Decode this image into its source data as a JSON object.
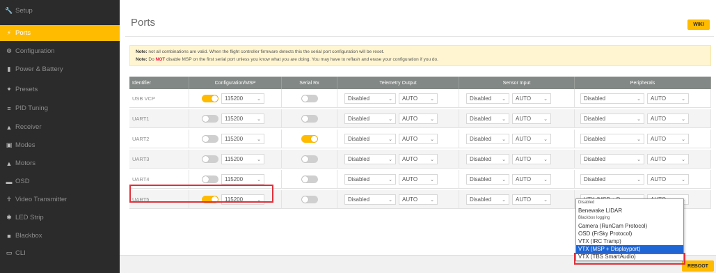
{
  "sidebar": {
    "items": [
      {
        "label": "Setup",
        "icon": "wrench-icon"
      },
      {
        "label": "Ports",
        "icon": "plug-icon",
        "active": true
      },
      {
        "label": "Configuration",
        "icon": "gear-icon"
      },
      {
        "label": "Power & Battery",
        "icon": "battery-icon"
      },
      {
        "label": "Presets",
        "icon": "wand-icon"
      },
      {
        "label": "PID Tuning",
        "icon": "bars-icon"
      },
      {
        "label": "Receiver",
        "icon": "receiver-icon"
      },
      {
        "label": "Modes",
        "icon": "modes-icon"
      },
      {
        "label": "Motors",
        "icon": "motor-icon"
      },
      {
        "label": "OSD",
        "icon": "osd-icon"
      },
      {
        "label": "Video Transmitter",
        "icon": "antenna-icon"
      },
      {
        "label": "LED Strip",
        "icon": "led-icon"
      },
      {
        "label": "Blackbox",
        "icon": "blackbox-icon"
      },
      {
        "label": "CLI",
        "icon": "terminal-icon"
      }
    ]
  },
  "header": {
    "title": "Ports",
    "wiki_label": "WIKI"
  },
  "notes": {
    "line1_prefix": "Note:",
    "line1_text": " not all combinations are valid. When the flight controller firmware detects this the serial port configuration will be reset.",
    "line2_prefix": "Note:",
    "line2_mid1": " Do ",
    "line2_not": "NOT",
    "line2_text": " disable MSP on the first serial port unless you know what you are doing. You may have to reflash and erase your configuration if you do."
  },
  "table": {
    "headers": [
      "Identifier",
      "Configuration/MSP",
      "Serial Rx",
      "Telemetry Output",
      "Sensor Input",
      "Peripherals"
    ],
    "rows": [
      {
        "id": "USB VCP",
        "msp_on": true,
        "msp_baud": "115200",
        "rx_on": false,
        "telem": "Disabled",
        "telem_baud": "AUTO",
        "sensor": "Disabled",
        "sensor_baud": "AUTO",
        "periph": "Disabled",
        "periph_baud": "AUTO"
      },
      {
        "id": "UART1",
        "msp_on": false,
        "msp_baud": "115200",
        "rx_on": false,
        "telem": "Disabled",
        "telem_baud": "AUTO",
        "sensor": "Disabled",
        "sensor_baud": "AUTO",
        "periph": "Disabled",
        "periph_baud": "AUTO"
      },
      {
        "id": "UART2",
        "msp_on": false,
        "msp_baud": "115200",
        "rx_on": true,
        "telem": "Disabled",
        "telem_baud": "AUTO",
        "sensor": "Disabled",
        "sensor_baud": "AUTO",
        "periph": "Disabled",
        "periph_baud": "AUTO"
      },
      {
        "id": "UART3",
        "msp_on": false,
        "msp_baud": "115200",
        "rx_on": false,
        "telem": "Disabled",
        "telem_baud": "AUTO",
        "sensor": "Disabled",
        "sensor_baud": "AUTO",
        "periph": "Disabled",
        "periph_baud": "AUTO"
      },
      {
        "id": "UART4",
        "msp_on": false,
        "msp_baud": "115200",
        "rx_on": false,
        "telem": "Disabled",
        "telem_baud": "AUTO",
        "sensor": "Disabled",
        "sensor_baud": "AUTO",
        "periph": "Disabled",
        "periph_baud": "AUTO"
      },
      {
        "id": "UART5",
        "msp_on": true,
        "msp_baud": "115200",
        "rx_on": false,
        "telem": "Disabled",
        "telem_baud": "AUTO",
        "sensor": "Disabled",
        "sensor_baud": "AUTO",
        "periph": "VTX (MSP + D",
        "periph_baud": "AUTO"
      }
    ]
  },
  "dropdown": {
    "options": [
      {
        "label": "Disabled",
        "small": true
      },
      {
        "label": "Benewake LIDAR"
      },
      {
        "label": "Blackbox logging",
        "small": true
      },
      {
        "label": "Camera (RunCam Protocol)"
      },
      {
        "label": "OSD (FrSky Protocol)"
      },
      {
        "label": "VTX (IRC Tramp)"
      },
      {
        "label": "VTX (MSP + Displayport)",
        "selected": true
      },
      {
        "label": "VTX (TBS SmartAudio)"
      }
    ]
  },
  "footer": {
    "reboot_label": "REBOOT"
  },
  "colors": {
    "accent": "#ffbb00",
    "sidebar_bg": "#2b2b2b",
    "header_bg": "#828885",
    "highlight": "#e0303a",
    "select_blue": "#1e66d6"
  }
}
